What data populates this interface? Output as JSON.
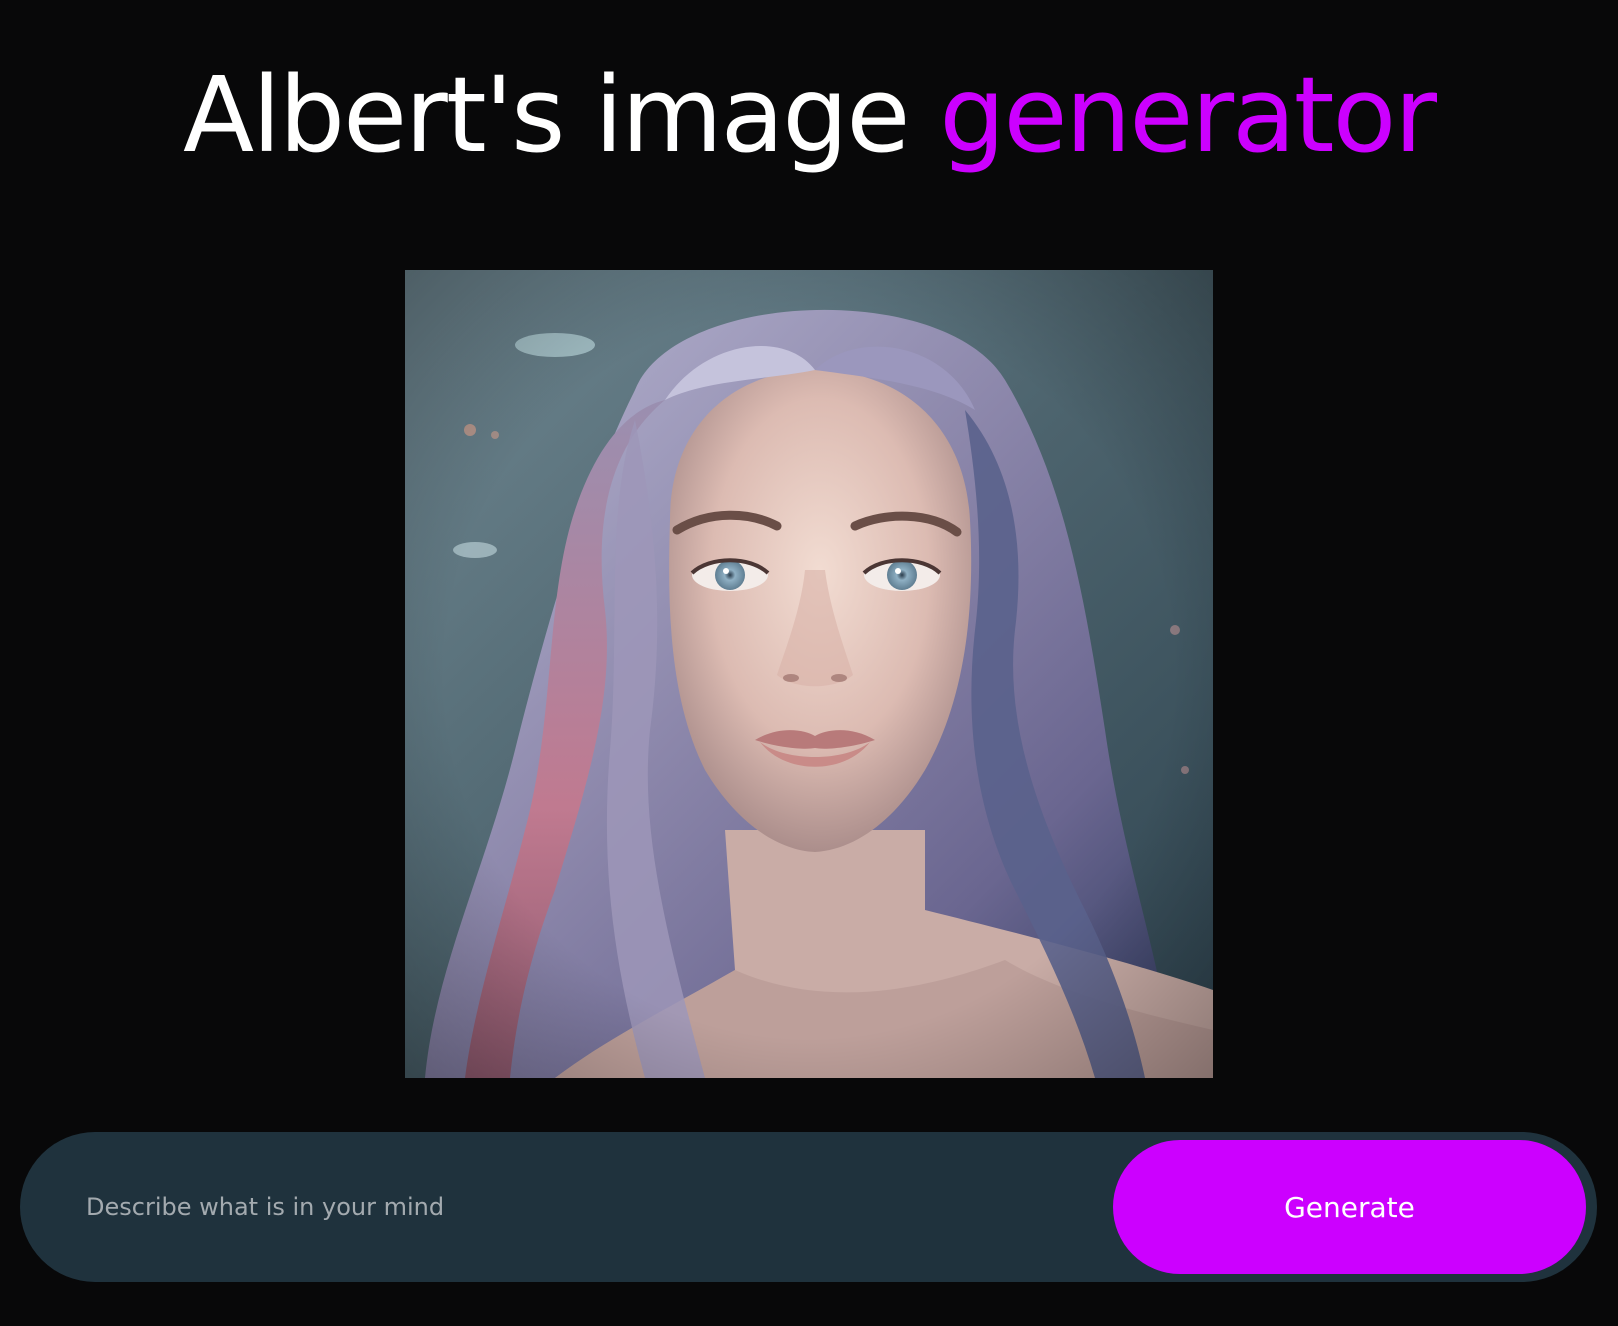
{
  "header": {
    "title_main": "Albert's image ",
    "title_accent": "generator"
  },
  "image": {
    "alt": "portrait-image"
  },
  "prompt": {
    "placeholder": "Describe what is in your mind",
    "value": "",
    "button_label": "Generate"
  },
  "colors": {
    "background": "#080809",
    "accent": "#cc00ff",
    "prompt_bar": "#1f323d",
    "placeholder": "#a3aaaf"
  }
}
